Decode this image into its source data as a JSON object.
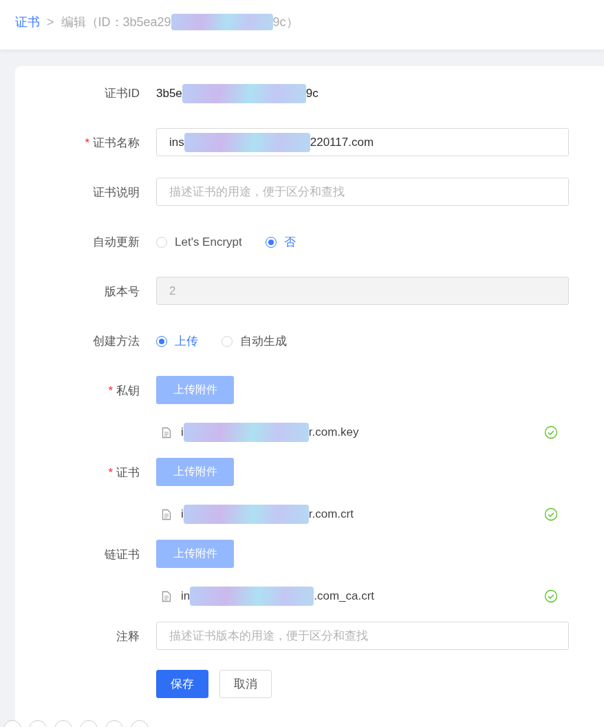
{
  "breadcrumb": {
    "root": "证书",
    "separator": ">",
    "current_prefix": "编辑（ID：3b5ea29",
    "current_suffix": "9c）"
  },
  "form": {
    "fields": [
      {
        "kind": "text",
        "label": "证书ID",
        "value_prefix": "3b5e",
        "value_suffix": "9c"
      },
      {
        "kind": "input",
        "label": "证书名称",
        "required_mark": "*",
        "disabled": false,
        "value_prefix": "ins",
        "value_suffix": "220117.com"
      },
      {
        "kind": "input",
        "label": "证书说明",
        "disabled": false,
        "placeholder": "描述证书的用途，便于区分和查找"
      },
      {
        "kind": "radio",
        "label": "自动更新",
        "options": [
          {
            "label": "Let's Encrypt",
            "selected": false
          },
          {
            "label": "否",
            "selected": true
          }
        ]
      },
      {
        "kind": "input",
        "label": "版本号",
        "disabled": true,
        "value": "2"
      },
      {
        "kind": "radio",
        "label": "创建方法",
        "options": [
          {
            "label": "上传",
            "selected": true
          },
          {
            "label": "自动生成",
            "selected": false
          }
        ]
      },
      {
        "kind": "upload",
        "label": "私钥",
        "required_mark": "*",
        "button": "上传附件",
        "file": {
          "name_prefix": "i",
          "name_suffix": "r.com.key",
          "done": true
        }
      },
      {
        "kind": "upload",
        "label": "证书",
        "required_mark": "*",
        "button": "上传附件",
        "file": {
          "name_prefix": "i",
          "name_suffix": "r.com.crt",
          "done": true
        }
      },
      {
        "kind": "upload",
        "label": "链证书",
        "button": "上传附件",
        "file": {
          "name_prefix": "in",
          "name_suffix": ".com_ca.crt",
          "done": true
        }
      },
      {
        "kind": "input",
        "label": "注释",
        "disabled": false,
        "placeholder": "描述证书版本的用途，便于区分和查找"
      }
    ],
    "buttons": [
      {
        "label": "保存",
        "kind": "primary"
      },
      {
        "label": "取消",
        "kind": "default"
      }
    ]
  }
}
